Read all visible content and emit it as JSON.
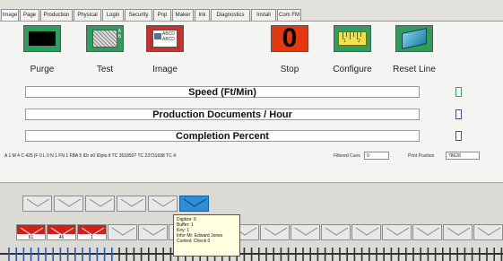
{
  "tabs": [
    {
      "label": "Image",
      "active": true
    },
    {
      "label": "Page",
      "active": false
    },
    {
      "label": "Production",
      "active": false
    },
    {
      "label": "Physical",
      "active": false
    },
    {
      "label": "Login",
      "active": false
    },
    {
      "label": "Security",
      "active": false
    },
    {
      "label": "Pnp",
      "active": false
    },
    {
      "label": "Maker",
      "active": false
    },
    {
      "label": "Ink",
      "active": false
    },
    {
      "label": "Diagnostics",
      "active": false
    },
    {
      "label": "Install",
      "active": false
    },
    {
      "label": "Com FM",
      "active": false
    }
  ],
  "toolbar": {
    "purge_label": "Purge",
    "test_label": "Test",
    "test_icon_letters": "A\nB",
    "image_label": "Image",
    "image_icon_text": "ABCD\nABCD",
    "stop_label": "Stop",
    "stop_count": "0",
    "configure_label": "Configure",
    "configure_ruler_1": "1",
    "configure_ruler_2": "2",
    "reset_label": "Reset Line"
  },
  "meters": [
    {
      "label": "Speed (Ft/Min)",
      "indicator_color": "#3aa35a"
    },
    {
      "label": "Production Documents / Hour",
      "indicator_color": "#4050a0"
    },
    {
      "label": "Completion Percent",
      "indicator_color": "#555555"
    }
  ],
  "status": {
    "line": "A 1 M 4 C 425 |F 0 L 0 N 1 FN 1 FBA 5 IDr e0 IDpto if TC 3518507 TC 23731698 TC 4:",
    "filtered_cues_label": "Filtered Cues",
    "filtered_cues_value": "0",
    "print_position_label": "Print Position",
    "print_position_value": "78628"
  },
  "pockets_row1": [
    {
      "state": "empty"
    },
    {
      "state": "empty"
    },
    {
      "state": "empty"
    },
    {
      "state": "empty"
    },
    {
      "state": "empty"
    },
    {
      "state": "active"
    }
  ],
  "pockets_row2": [
    {
      "state": "filled",
      "count": "61"
    },
    {
      "state": "filled",
      "count": "46"
    },
    {
      "state": "filled",
      "count": "1"
    },
    {
      "state": "empty"
    },
    {
      "state": "empty"
    },
    {
      "state": "empty"
    },
    {
      "state": "empty"
    },
    {
      "state": "empty"
    },
    {
      "state": "empty"
    },
    {
      "state": "empty"
    },
    {
      "state": "empty"
    },
    {
      "state": "empty"
    },
    {
      "state": "empty"
    },
    {
      "state": "empty"
    },
    {
      "state": "empty"
    },
    {
      "state": "empty"
    }
  ],
  "tooltip": {
    "lines": [
      "Digitize: 6",
      "Buffer: 1",
      "Key: 1",
      "Infor Mr. Edward Jones",
      "Control: Check 0"
    ]
  },
  "colors": {
    "stop_red": "#e43712",
    "icon_green": "#2f9e5c",
    "pocket_blue": "#2c8fd8",
    "pocket_red": "#d41e16",
    "rail_blue": "#2a58b8",
    "rail_dark": "#333333"
  }
}
